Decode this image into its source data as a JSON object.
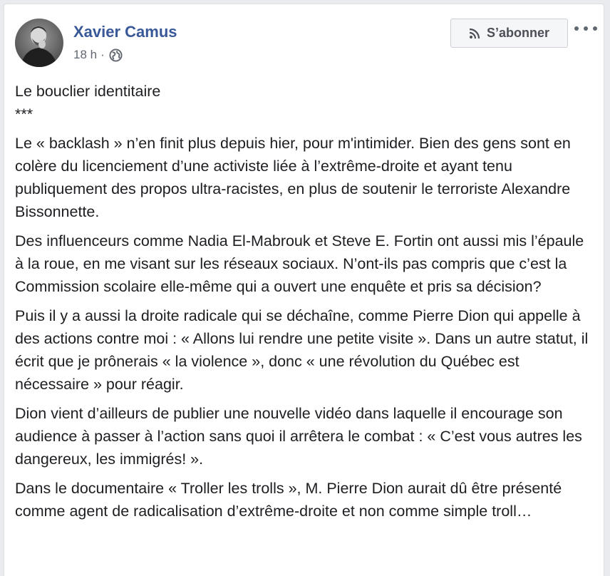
{
  "post": {
    "author": "Xavier Camus",
    "time": "18 h",
    "separator": "·",
    "subscribe_label": "S’abonner",
    "icons": {
      "rss": "rss-icon",
      "privacy": "globe-icon",
      "more": "more-options-icon"
    },
    "title": "Le bouclier identitaire",
    "divider": "***",
    "paragraphs": [
      "Le « backlash » n’en finit plus depuis hier, pour m'intimider. Bien des gens sont en colère du licenciement d’une activiste liée à l’extrême-droite et ayant tenu publiquement des propos ultra-racistes, en plus de soutenir le terroriste Alexandre Bissonnette.",
      "Des influenceurs comme Nadia El-Mabrouk et Steve E. Fortin ont aussi mis l’épaule à la roue, en me visant sur les réseaux sociaux. N’ont-ils pas compris que c’est la Commission scolaire elle-même qui a ouvert une enquête et pris sa décision?",
      "Puis il y a aussi la droite radicale qui se déchaîne, comme Pierre Dion qui appelle à des actions contre moi : « Allons lui rendre une petite visite ». Dans un autre statut, il écrit que je prônerais « la violence », donc « une révolution du Québec est nécessaire » pour réagir.",
      "Dion vient d’ailleurs de publier une nouvelle vidéo dans laquelle il encourage son audience à passer à l’action sans quoi il arrêtera le combat : « C’est vous autres les dangereux, les immigrés! ».",
      "Dans le documentaire « Troller les trolls », M. Pierre Dion aurait dû être présenté comme agent de radicalisation d’extrême-droite et non comme simple troll…"
    ]
  },
  "colors": {
    "author_link": "#385898",
    "body_text": "#1c1e21",
    "meta_text": "#616770",
    "page_background": "#e9ebee"
  }
}
